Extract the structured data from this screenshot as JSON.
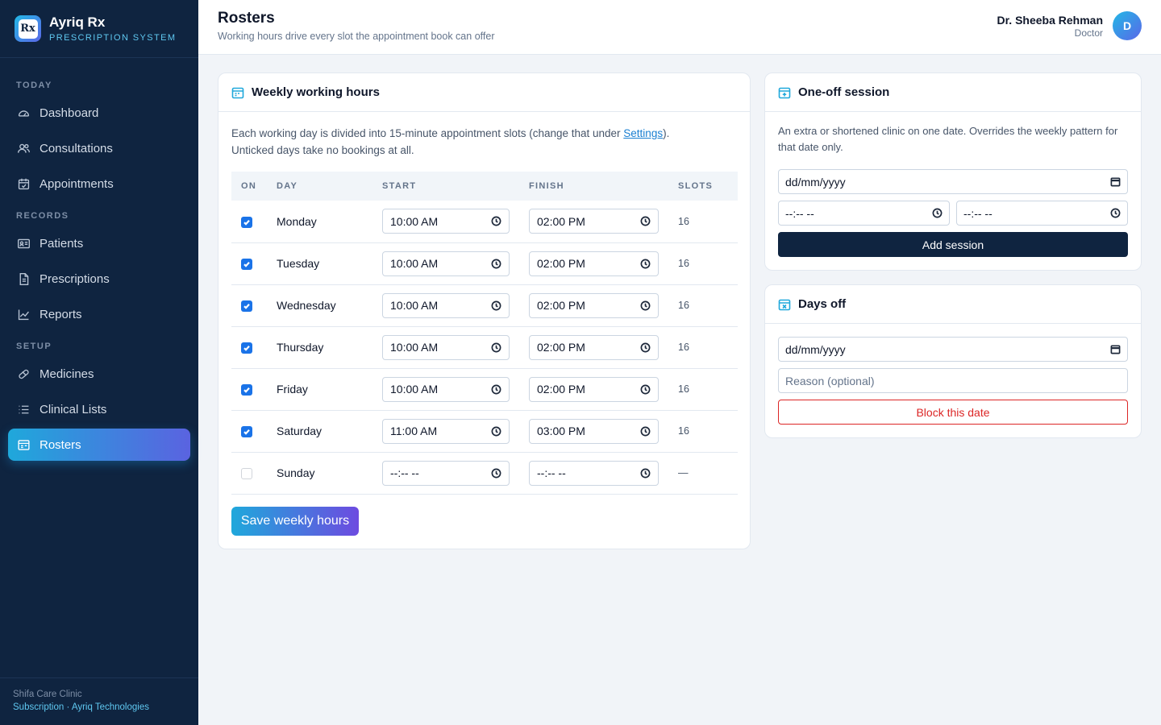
{
  "brand": {
    "name": "Ayriq Rx",
    "subtitle": "PRESCRIPTION SYSTEM",
    "logo_text": "Rx"
  },
  "sidebar": {
    "sections": [
      {
        "label": "TODAY",
        "items": [
          {
            "label": "Dashboard",
            "icon": "gauge-icon"
          },
          {
            "label": "Consultations",
            "icon": "users-icon"
          },
          {
            "label": "Appointments",
            "icon": "calendar-check-icon"
          }
        ]
      },
      {
        "label": "RECORDS",
        "items": [
          {
            "label": "Patients",
            "icon": "id-card-icon"
          },
          {
            "label": "Prescriptions",
            "icon": "document-icon"
          },
          {
            "label": "Reports",
            "icon": "line-chart-icon"
          }
        ]
      },
      {
        "label": "SETUP",
        "items": [
          {
            "label": "Medicines",
            "icon": "pill-icon"
          },
          {
            "label": "Clinical Lists",
            "icon": "list-icon"
          },
          {
            "label": "Rosters",
            "icon": "roster-icon",
            "active": true
          }
        ]
      }
    ],
    "footer": {
      "clinic": "Shifa Care Clinic",
      "links": "Subscription · Ayriq Technologies"
    }
  },
  "header": {
    "title": "Rosters",
    "subtitle": "Working hours drive every slot the appointment book can offer",
    "user": {
      "name": "Dr. Sheeba Rehman",
      "role": "Doctor",
      "initial": "D"
    }
  },
  "weekly": {
    "title": "Weekly working hours",
    "intro_before": "Each working day is divided into 15-minute appointment slots (change that under ",
    "intro_link": "Settings",
    "intro_after": ").",
    "intro_line2": "Unticked days take no bookings at all.",
    "columns": {
      "on": "ON",
      "day": "DAY",
      "start": "START",
      "finish": "FINISH",
      "slots": "SLOTS"
    },
    "rows": [
      {
        "on": true,
        "day": "Monday",
        "start": "10:00  AM",
        "finish": "02:00  PM",
        "slots": "16"
      },
      {
        "on": true,
        "day": "Tuesday",
        "start": "10:00  AM",
        "finish": "02:00  PM",
        "slots": "16"
      },
      {
        "on": true,
        "day": "Wednesday",
        "start": "10:00  AM",
        "finish": "02:00  PM",
        "slots": "16"
      },
      {
        "on": true,
        "day": "Thursday",
        "start": "10:00  AM",
        "finish": "02:00  PM",
        "slots": "16"
      },
      {
        "on": true,
        "day": "Friday",
        "start": "10:00  AM",
        "finish": "02:00  PM",
        "slots": "16"
      },
      {
        "on": true,
        "day": "Saturday",
        "start": "11:00  AM",
        "finish": "03:00  PM",
        "slots": "16"
      },
      {
        "on": false,
        "day": "Sunday",
        "start": "--:-- --",
        "finish": "--:-- --",
        "slots": "—"
      }
    ],
    "save_label": "Save weekly hours"
  },
  "oneoff": {
    "title": "One-off session",
    "intro": "An extra or shortened clinic on one date. Overrides the weekly pattern for that date only.",
    "date_placeholder": "dd/mm/yyyy",
    "start_placeholder": "--:-- --",
    "finish_placeholder": "--:-- --",
    "add_label": "Add session"
  },
  "daysoff": {
    "title": "Days off",
    "date_placeholder": "dd/mm/yyyy",
    "reason_placeholder": "Reason (optional)",
    "block_label": "Block this date"
  },
  "colors": {
    "sidebar_bg": "#0f2440",
    "accent_start": "#1fa8db",
    "accent_end": "#5a63e0",
    "danger": "#dc2626",
    "checkbox": "#1a73e8"
  }
}
